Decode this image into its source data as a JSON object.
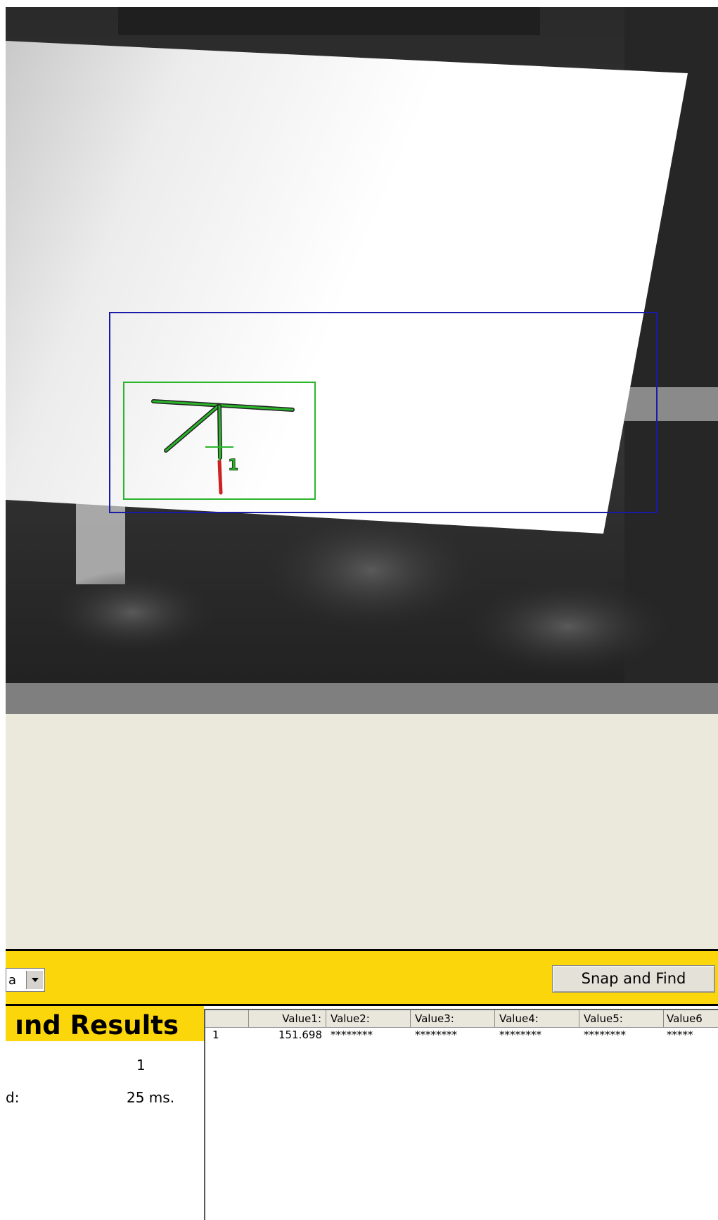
{
  "camera": {
    "match_label": "1"
  },
  "toolbar": {
    "combo_value": "a",
    "snap_label": "Snap and Find"
  },
  "results": {
    "title": "ınd Results",
    "count_label": "",
    "count_value": "1",
    "time_label": "d:",
    "time_value": "25 ms."
  },
  "grid": {
    "columns": [
      "",
      "Value1:",
      "Value2:",
      "Value3:",
      "Value4:",
      "Value5:",
      "Value6"
    ],
    "rows": [
      [
        "1",
        "151.698",
        "********",
        "********",
        "********",
        "********",
        "*****"
      ]
    ]
  },
  "colors": {
    "toolbar_bg": "#fbd60a",
    "beige_bg": "#ebe8dc",
    "divider_bg": "#7f7f7f",
    "roi_blue": "#1a1aa8",
    "match_green": "#2bb52b"
  }
}
